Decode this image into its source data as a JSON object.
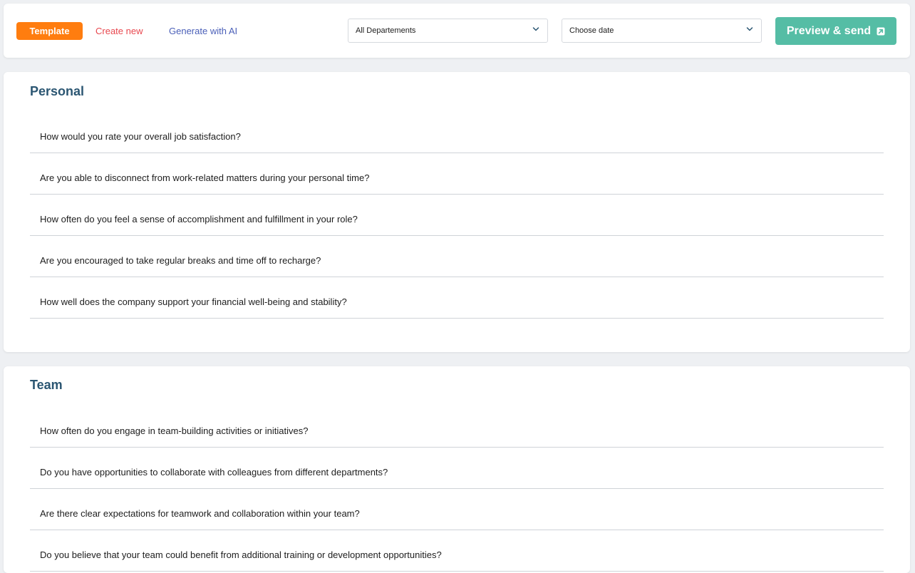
{
  "toolbar": {
    "tabs": {
      "template": "Template",
      "create_new": "Create new",
      "generate_ai": "Generate with AI"
    },
    "department_select": {
      "value": "All Departements"
    },
    "date_select": {
      "value": "Choose date"
    },
    "preview_button": "Preview & send"
  },
  "colors": {
    "template_tab": "#ff7d0f",
    "create_new_text": "#e8484f",
    "generate_ai_text": "#4a5fb8",
    "preview_button": "#55bda5",
    "section_title": "#2b5672"
  },
  "icons": {
    "select_chevron": "chevron-down-icon",
    "preview": "external-link-icon"
  },
  "sections": [
    {
      "title": "Personal",
      "questions": [
        "How would you rate your overall job satisfaction?",
        "Are you able to disconnect from work-related matters during your personal time?",
        "How often do you feel a sense of accomplishment and fulfillment in your role?",
        "Are you encouraged to take regular breaks and time off to recharge?",
        "How well does the company support your financial well-being and stability?"
      ]
    },
    {
      "title": "Team",
      "questions": [
        "How often do you engage in team-building activities or initiatives?",
        "Do you have opportunities to collaborate with colleagues from different departments?",
        "Are there clear expectations for teamwork and collaboration within your team?",
        "Do you believe that your team could benefit from additional training or development opportunities?"
      ]
    }
  ]
}
